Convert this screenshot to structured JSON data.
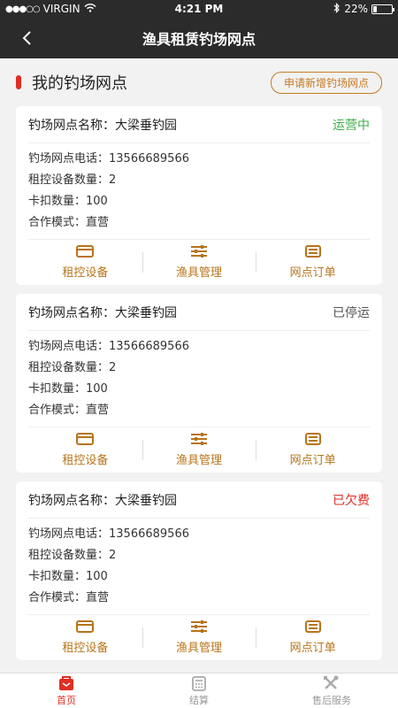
{
  "statusbar": {
    "carrier": "VIRGIN",
    "time": "4:21 PM",
    "battery": "22%",
    "battery_level": 0.22
  },
  "navbar": {
    "title": "渔具租赁钓场网点"
  },
  "section": {
    "title": "我的钓场网点",
    "apply_label": "申请新增钓场网点"
  },
  "cards": [
    {
      "name": "钓场网点名称：大梁垂钓园",
      "status": "运营中",
      "status_color": "#3fae4a",
      "phone": "钓场网点电话：13566689566",
      "devices": "租控设备数量：2",
      "buckles": "卡扣数量：100",
      "mode": "合作模式：直营",
      "actions": [
        "租控设备",
        "渔具管理",
        "网点订单"
      ]
    },
    {
      "name": "钓场网点名称：大梁垂钓园",
      "status": "已停运",
      "status_color": "#555555",
      "phone": "钓场网点电话：13566689566",
      "devices": "租控设备数量：2",
      "buckles": "卡扣数量：100",
      "mode": "合作模式：直营",
      "actions": [
        "租控设备",
        "渔具管理",
        "网点订单"
      ]
    },
    {
      "name": "钓场网点名称：大梁垂钓园",
      "status": "已欠费",
      "status_color": "#e02e24",
      "phone": "钓场网点电话：13566689566",
      "devices": "租控设备数量：2",
      "buckles": "卡扣数量：100",
      "mode": "合作模式：直营",
      "actions": [
        "租控设备",
        "渔具管理",
        "网点订单"
      ]
    }
  ],
  "tabbar": {
    "tabs": [
      "首页",
      "结算",
      "售后服务"
    ],
    "active_color": "#e02e24"
  },
  "colors": {
    "accent": "#b8741a",
    "nav_bg": "#2b2b2b"
  }
}
